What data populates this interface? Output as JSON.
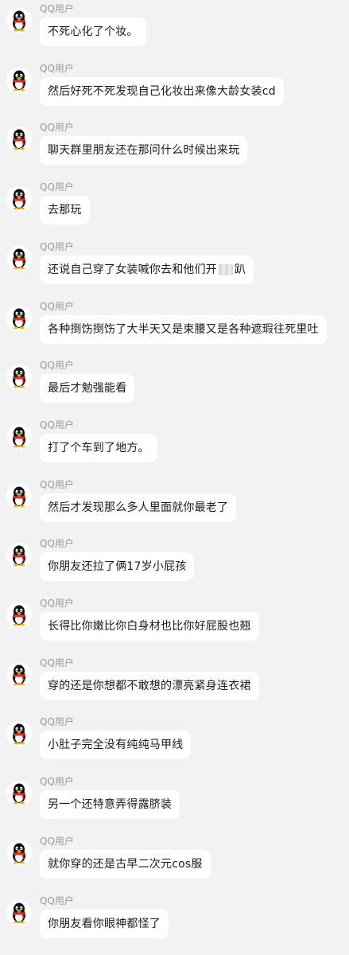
{
  "sender_name": "QQ用户",
  "avatar_icon": "qq-penguin-icon",
  "colors": {
    "background": "#f2f2f2",
    "bubble": "#ffffff",
    "sender": "#999999",
    "text": "#1a1a1a",
    "scarf": "#e8262b",
    "beak": "#f7b500"
  },
  "messages": [
    {
      "text": "不死心化了个妆。"
    },
    {
      "text": "然后好死不死发现自己化妆出来像大龄女装cd"
    },
    {
      "text": "聊天群里朋友还在那问什么时候出来玩"
    },
    {
      "text": "去那玩"
    },
    {
      "text": "还说自己穿了女装喊你去和他们开",
      "text_after": "趴",
      "redacted": true
    },
    {
      "text": "各种捯饬捯饬了大半天又是束腰又是各种遮瑕往死里吐"
    },
    {
      "text": "最后才勉强能看"
    },
    {
      "text": "打了个车到了地方。"
    },
    {
      "text": "然后才发现那么多人里面就你最老了"
    },
    {
      "text": "你朋友还拉了俩17岁小屁孩"
    },
    {
      "text": "长得比你嫩比你白身材也比你好屁股也翘"
    },
    {
      "text": "穿的还是你想都不敢想的漂亮紧身连衣裙"
    },
    {
      "text": "小肚子完全没有纯纯马甲线"
    },
    {
      "text": "另一个还特意弄得露脐装"
    },
    {
      "text": "就你穿的还是古早二次元cos服"
    },
    {
      "text": "你朋友看你眼神都怪了"
    }
  ]
}
